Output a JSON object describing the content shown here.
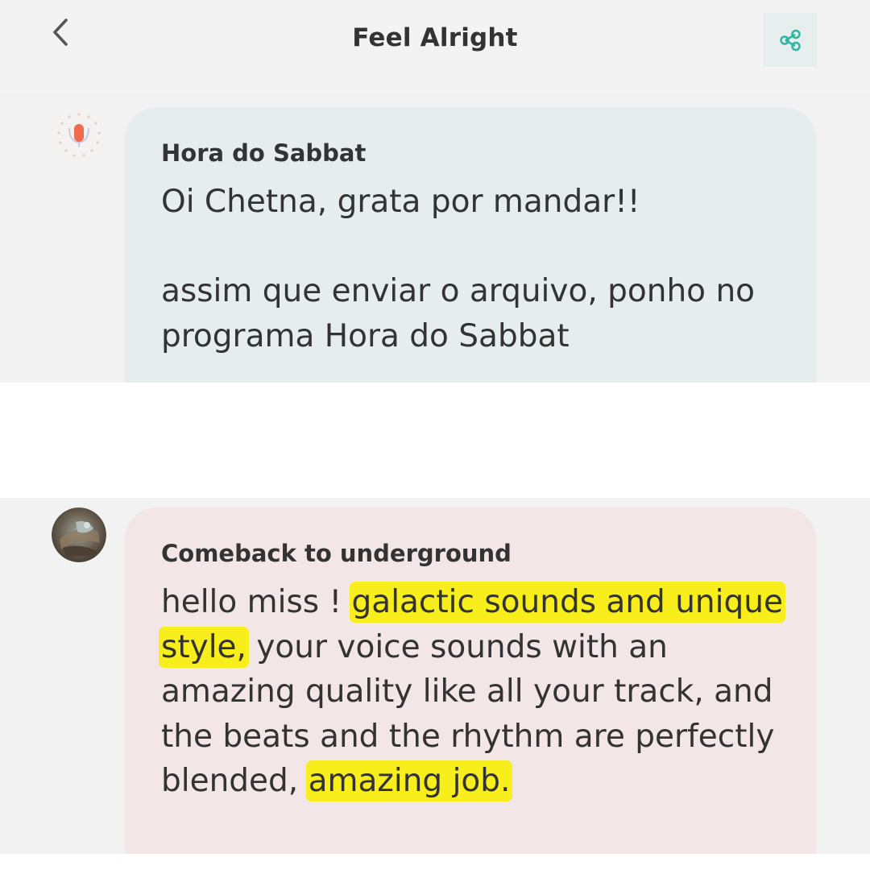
{
  "header": {
    "title": "Feel Alright",
    "back_icon": "chevron-left-icon",
    "share_icon": "share-icon",
    "accent_color": "#2fb6a0"
  },
  "messages": [
    {
      "sender": "Hora do Sabbat",
      "text": "Oi Chetna, grata por mandar!!\n\nassim que enviar o arquivo, ponho no programa Hora do Sabbat",
      "bubble_color": "#e6eeed",
      "avatar": "microphone-logo"
    },
    {
      "sender": "Comeback to underground",
      "text_parts": [
        "hello miss ! ",
        "galactic sounds and unique style,",
        " your voice sounds with an amazing quality like all your track, and the beats and the rhythm are perfectly blended, ",
        "amazing job."
      ],
      "bubble_color": "#f2e6e7",
      "highlight_color": "#f7ee1c",
      "avatar": "user-photo"
    }
  ]
}
